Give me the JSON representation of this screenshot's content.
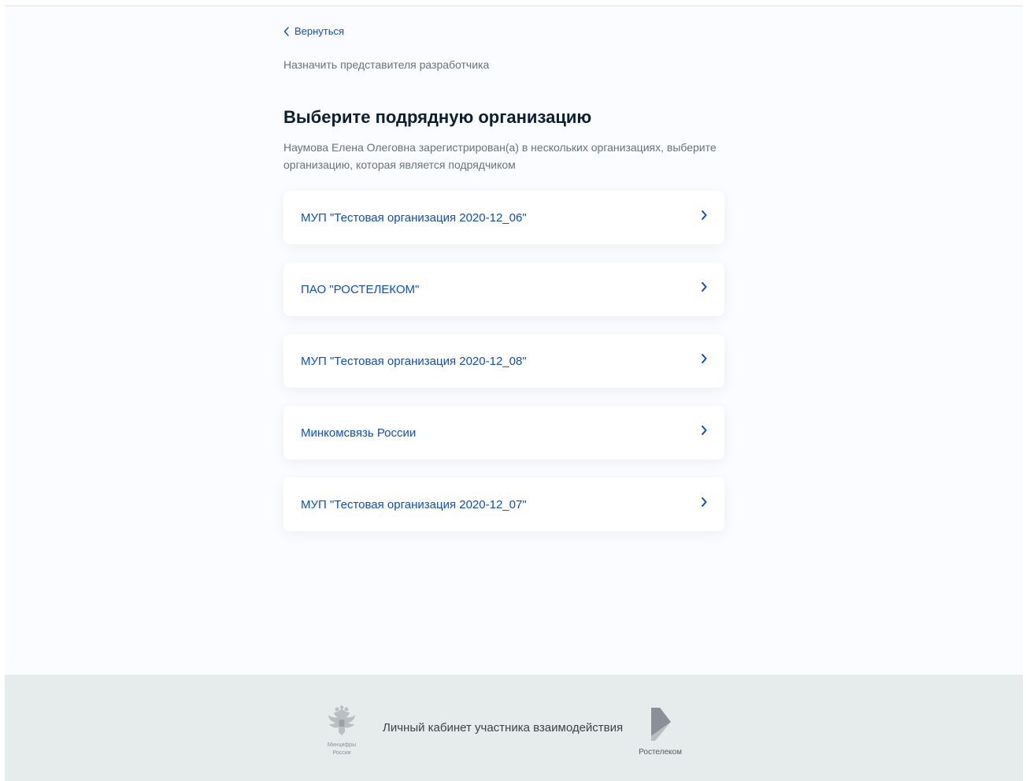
{
  "nav": {
    "back_label": "Вернуться"
  },
  "header": {
    "subtitle": "Назначить представителя разработчика",
    "title": "Выберите подрядную организацию",
    "description": "Наумова Елена Олеговна зарегистрирован(а) в нескольких организациях, выберите организацию, которая является подрядчиком"
  },
  "organizations": [
    {
      "name": "МУП \"Тестовая организация 2020-12_06\""
    },
    {
      "name": "ПАО \"РОСТЕЛЕКОМ\""
    },
    {
      "name": "МУП \"Тестовая организация 2020-12_08\""
    },
    {
      "name": "Минкомсвязь России"
    },
    {
      "name": "МУП \"Тестовая организация 2020-12_07\""
    }
  ],
  "footer": {
    "emblem_caption_line1": "Минцифры",
    "emblem_caption_line2": "России",
    "title": "Личный кабинет участника взаимодействия",
    "partner_name": "Ростелеком"
  },
  "colors": {
    "accent": "#0d4cd3",
    "page_background": "#fafcff",
    "footer_background": "#e6ebec",
    "heading": "#0b1f33",
    "secondary_text": "#66727f"
  },
  "icons": {
    "back": "chevron-left-icon",
    "card_arrow": "chevron-right-icon",
    "emblem": "coat-of-arms-icon",
    "partner_logo": "rostelecom-logo-icon"
  }
}
